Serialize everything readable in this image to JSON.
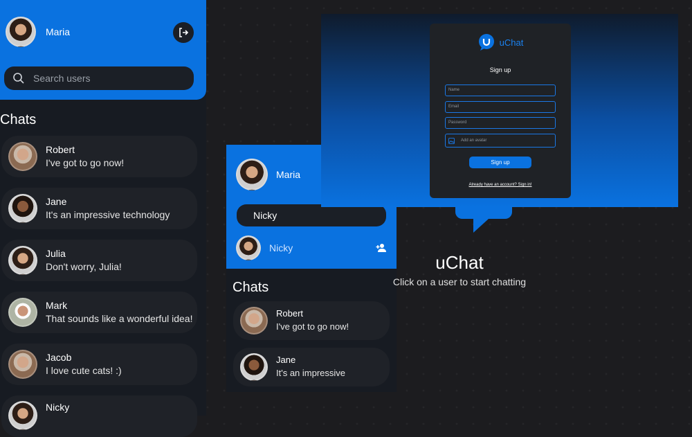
{
  "left": {
    "user_name": "Maria",
    "search_placeholder": "Search users",
    "chats_title": "Chats",
    "chats": [
      {
        "name": "Robert",
        "message": "I've got to go now!"
      },
      {
        "name": "Jane",
        "message": "It's an impressive technology"
      },
      {
        "name": "Julia",
        "message": "Don't worry, Julia!"
      },
      {
        "name": "Mark",
        "message": "That sounds like a wonderful idea!"
      },
      {
        "name": "Jacob",
        "message": "I love cute cats! :)"
      },
      {
        "name": "Nicky",
        "message": ""
      }
    ]
  },
  "middle": {
    "user_name": "Maria",
    "search_value": "Nicky",
    "search_result": "Nicky",
    "chats_title": "Chats",
    "chats": [
      {
        "name": "Robert",
        "message": "I've got to go now!"
      },
      {
        "name": "Jane",
        "message": "It's an impressive"
      }
    ]
  },
  "signup": {
    "brand": "uChat",
    "title": "Sign up",
    "fields": {
      "name": "Name",
      "email": "Email",
      "password": "Password",
      "avatar": "Add an avatar"
    },
    "button": "Sign up",
    "signin_link": "Already have an account? Sign in!"
  },
  "welcome": {
    "title": "uChat",
    "subtitle": "Click on a user to start chatting"
  },
  "colors": {
    "accent": "#0a72e0",
    "panel": "#171b22",
    "card": "#1f2228"
  }
}
